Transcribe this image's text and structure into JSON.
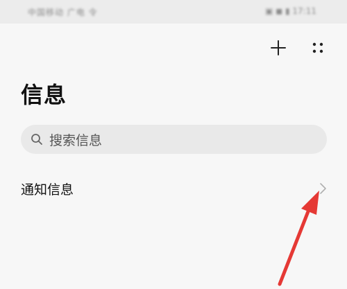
{
  "status_bar": {
    "left_text": "中国移动 广电 令",
    "right_text": "▣ ◼ ▮ 17:11"
  },
  "header": {
    "title": "信息",
    "add_icon": "plus-icon",
    "more_icon": "grid-dots-icon"
  },
  "search": {
    "placeholder": "搜索信息",
    "icon": "search-icon"
  },
  "list": {
    "items": [
      {
        "label": "通知信息",
        "icon": "chevron-right-icon"
      }
    ]
  },
  "annotation": {
    "arrow_color": "#e53935"
  }
}
